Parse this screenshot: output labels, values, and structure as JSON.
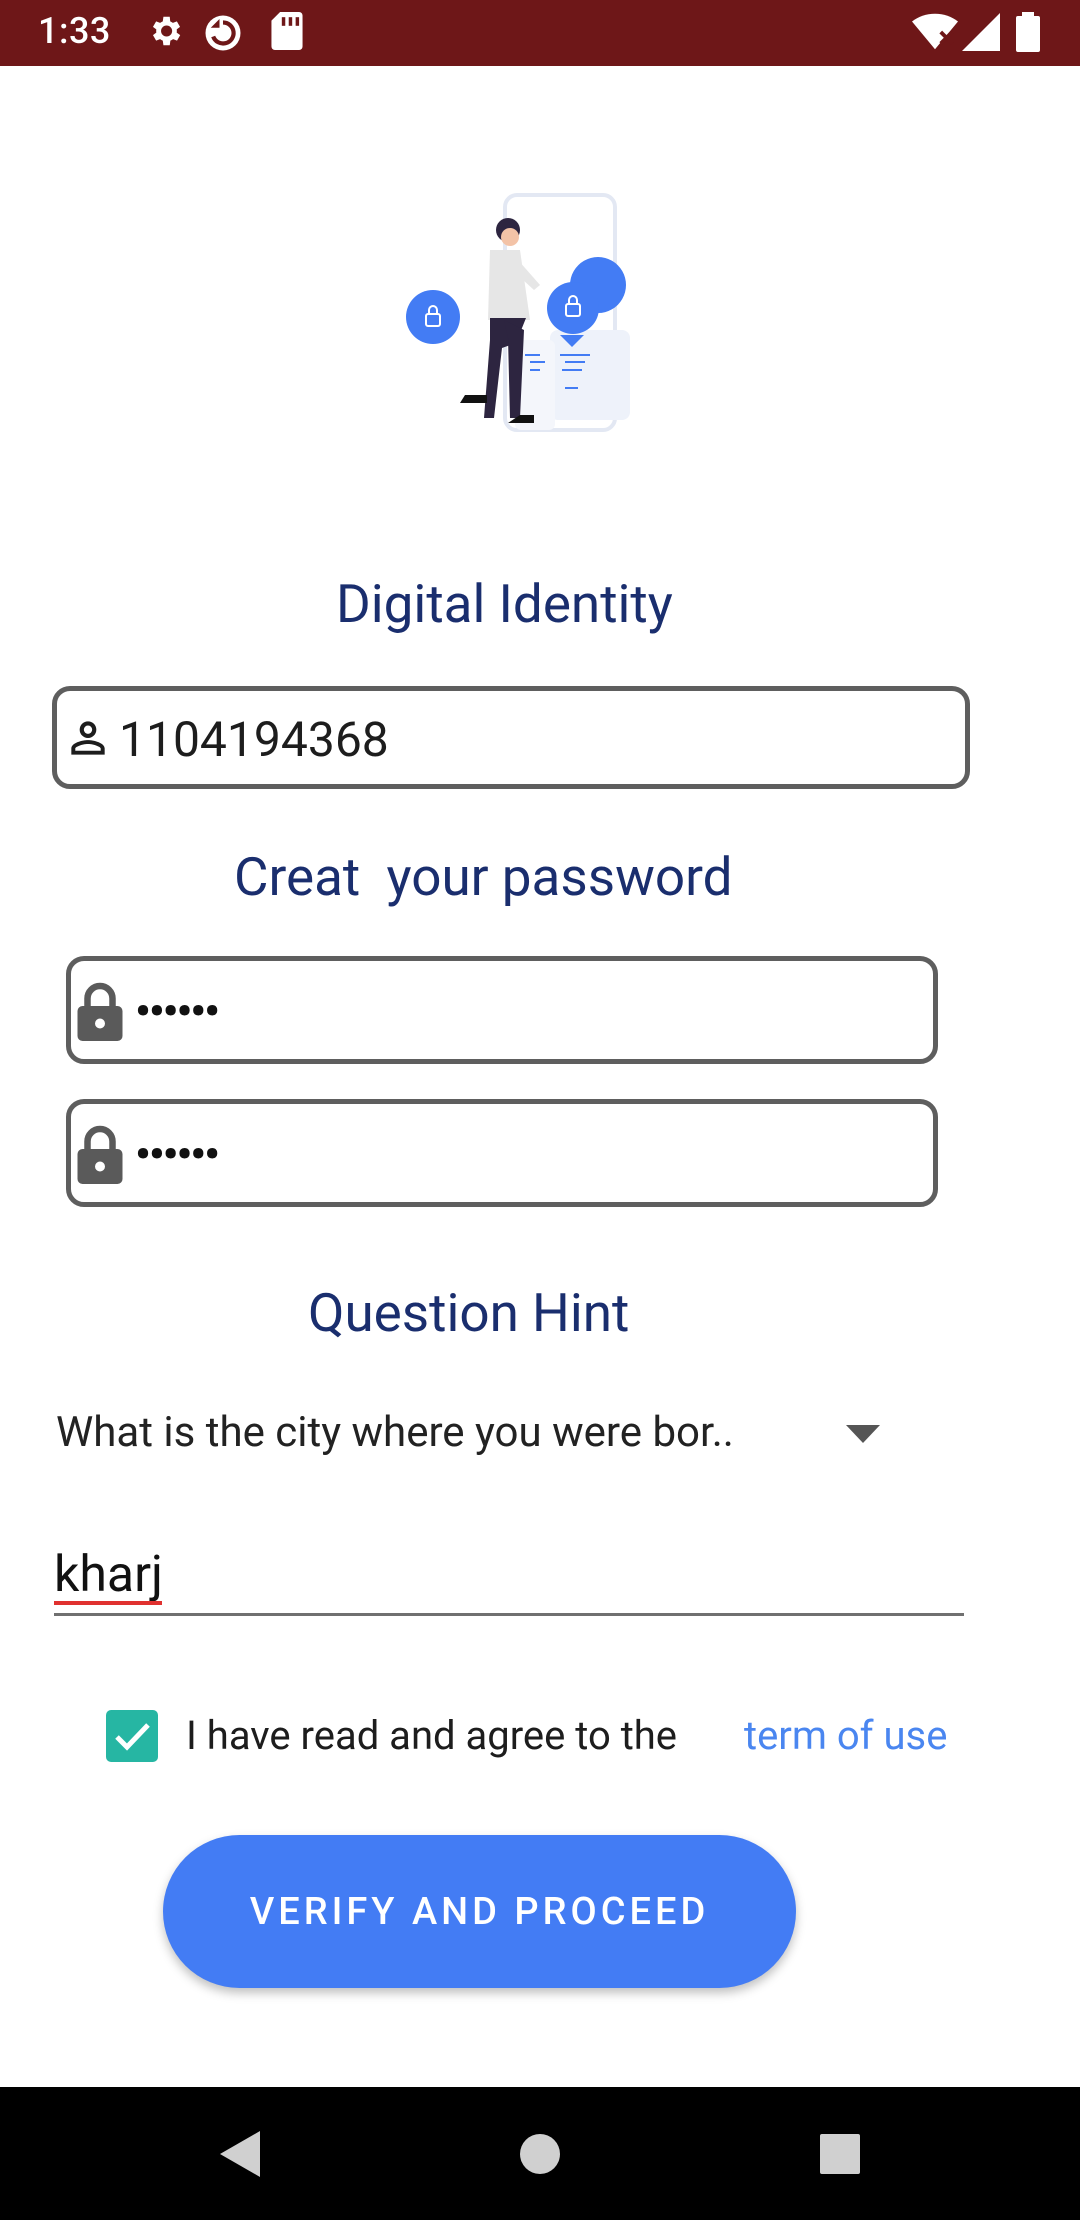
{
  "status_bar": {
    "time": "1:33",
    "icons": [
      "gear-icon",
      "sync-icon",
      "sd-card-icon",
      "wifi-icon",
      "signal-icon",
      "battery-icon"
    ]
  },
  "header": {
    "title": "Digital Identity"
  },
  "identity_field": {
    "value": "1104194368",
    "icon": "person-icon"
  },
  "password_section": {
    "title": "Creat  your password",
    "password_dots": "••••••",
    "confirm_dots": "••••••",
    "icon": "lock-icon"
  },
  "question_section": {
    "title": "Question Hint",
    "selected_question": "What is the city where you were bor..",
    "answer": "kharj"
  },
  "terms": {
    "checked": true,
    "label": "I have read and agree to the",
    "link": "term of use"
  },
  "actions": {
    "verify_label": "VERIFY AND PROCEED"
  },
  "colors": {
    "status_bar": "#6e1718",
    "heading": "#1a2e6e",
    "primary_button": "#437cf4",
    "link": "#4a86f0",
    "checkbox": "#26b6a3"
  }
}
